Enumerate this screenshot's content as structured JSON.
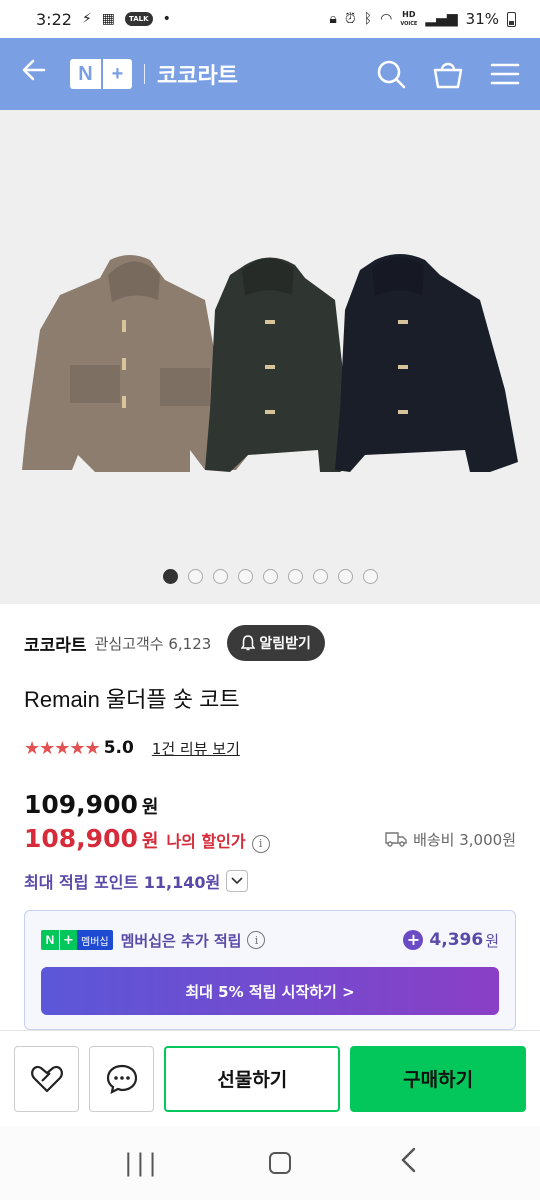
{
  "status_bar": {
    "time": "3:22",
    "talk": "TALK",
    "hd_top": "HD",
    "hd_bottom": "VOICE",
    "battery": "31%"
  },
  "header": {
    "logo_n": "N",
    "logo_plus": "+",
    "store_title": "코코라트"
  },
  "gallery": {
    "total_dots": 9,
    "active_index": 0
  },
  "store": {
    "name": "코코라트",
    "followers_label": "관심고객수",
    "followers_count": "6,123",
    "alarm_label": "알림받기"
  },
  "product": {
    "title": "Remain 울더플 숏 코트",
    "stars": "★★★★★",
    "rating": "5.0",
    "review_link": "1건 리뷰 보기"
  },
  "price": {
    "original": "109,900",
    "unit": "원",
    "sale": "108,900",
    "sale_label": "나의 할인가",
    "shipping": "배송비 3,000원",
    "points_text": "최대 적립 포인트 11,140원"
  },
  "membership": {
    "badge_n": "N",
    "badge_plus": "+",
    "badge_label": "멤버십",
    "text": "멤버십은 추가 적립",
    "points_amount": "4,396",
    "points_unit": "원",
    "cta": "최대 5% 적립 시작하기 >"
  },
  "actions": {
    "gift": "선물하기",
    "buy": "구매하기"
  },
  "colors": {
    "header_bg": "#7b9fe3",
    "sale_red": "#d62b3a",
    "purple": "#5b49a8",
    "naver_green": "#03c75a"
  }
}
